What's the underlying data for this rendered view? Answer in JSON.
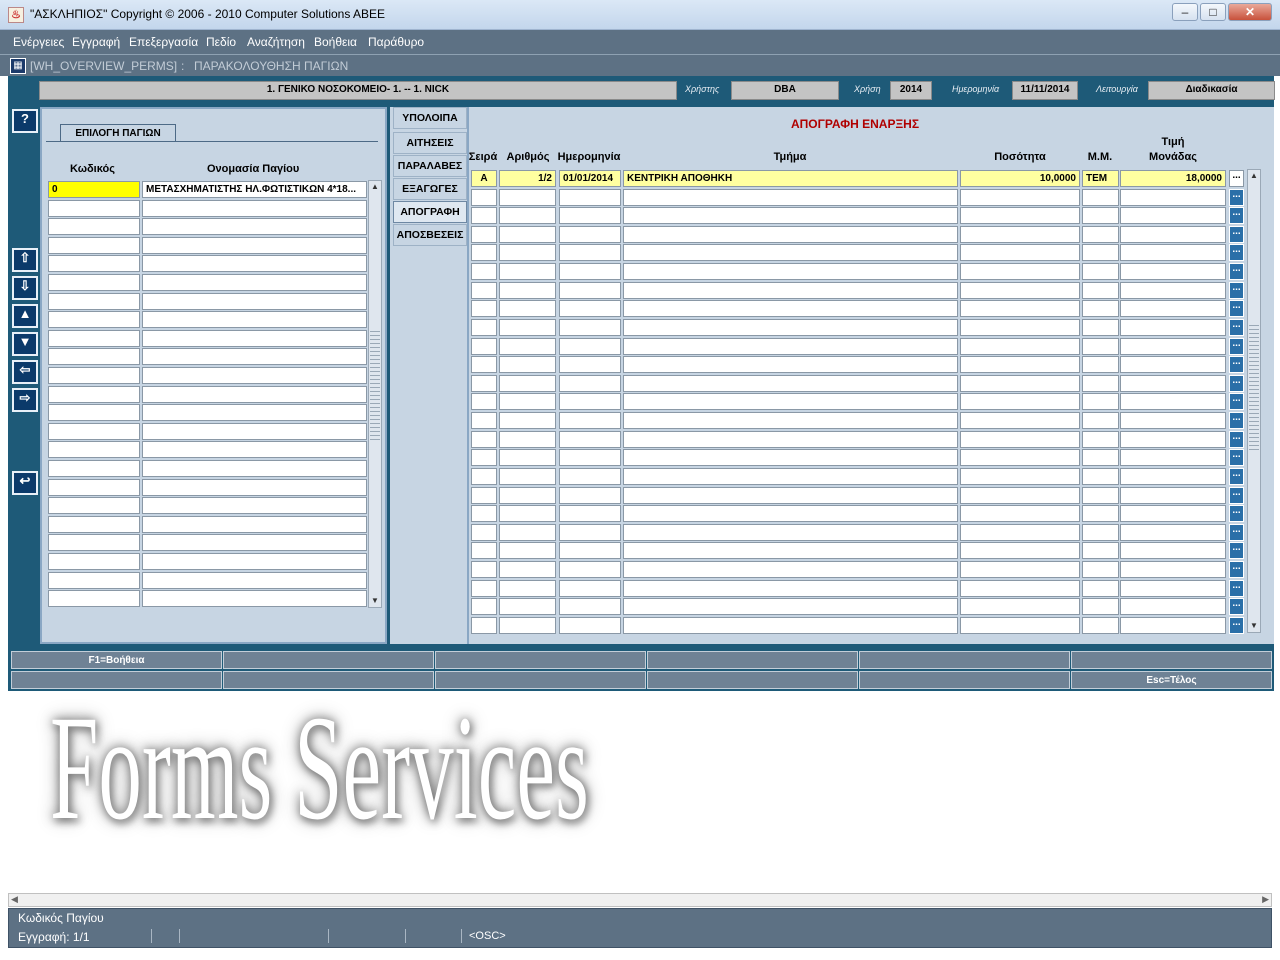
{
  "window": {
    "title": "\"ΑΣΚΛΗΠΙΟΣ\" Copyright © 2006 - 2010 Computer Solutions ABEE",
    "controls": [
      "–",
      "□",
      "✕"
    ]
  },
  "menu": [
    "Ενέργειες",
    "Εγγραφή",
    "Επεξεργασία",
    "Πεδίο",
    "Αναζήτηση",
    "Βοήθεια",
    "Παράθυρο"
  ],
  "breadcrumb": {
    "form": "[WH_OVERVIEW_PERMS]",
    "sep": ":",
    "title": "ΠΑΡΑΚΟΛΟΥΘΗΣΗ ΠΑΓΙΩΝ"
  },
  "info": {
    "org": "1. ΓΕΝΙΚΟ ΝΟΣΟΚΟΜΕΙΟ- 1. -- 1. NICK",
    "user_label": "Χρήστης",
    "user": "DBA",
    "year_label": "Χρήση",
    "year": "2014",
    "date_label": "Ημερομηνία",
    "date": "11/11/2014",
    "mode_label": "Λειτουργία",
    "mode": "Διαδικασία"
  },
  "toolbar": {
    "help": "?",
    "icons": [
      "arrow-up-icon",
      "arrow-down-icon",
      "triangle-up-icon",
      "triangle-down-icon",
      "arrow-left-icon",
      "arrow-right-icon",
      "undo-icon"
    ]
  },
  "left_panel": {
    "tab": "ΕΠΙΛΟΓΗ ΠΑΓΙΩΝ",
    "headers": {
      "code": "Κωδικός",
      "name": "Ονομασία Παγίου"
    },
    "rows": [
      {
        "code": "0",
        "name": "ΜΕΤΑΣΧΗΜΑΤΙΣΤΗΣ ΗΛ.ΦΩΤΙΣΤΙΚΩΝ 4*18..."
      }
    ]
  },
  "tabs": [
    "ΥΠΟΛΟΙΠΑ",
    "ΑΙΤΗΣΕΙΣ",
    "ΠΑΡΑΛΑΒΕΣ",
    "ΕΞΑΓΩΓΕΣ",
    "ΑΠΟΓΡΑΦΗ",
    "ΑΠΟΣΒΕΣΕΙΣ"
  ],
  "active_tab": "ΑΠΟΓΡΑΦΗ",
  "right_panel": {
    "title": "ΑΠΟΓΡΑΦΗ ΕΝΑΡΞΗΣ",
    "headers": {
      "series": "Σειρά",
      "number": "Αριθμός",
      "date": "Ημερομηνία",
      "department": "Τμήμα",
      "quantity": "Ποσότητα",
      "unit": "Μ.Μ.",
      "price_line1": "Τιμή",
      "price_line2": "Μονάδας"
    },
    "lov_button": "...",
    "rows": [
      {
        "series": "A",
        "number": "1/2",
        "date": "01/01/2014",
        "department": "ΚΕΝΤΡΙΚΗ ΑΠΟΘΗΚΗ",
        "quantity": "10,0000",
        "unit": "TEM",
        "price": "18,0000"
      }
    ]
  },
  "fkeys": {
    "row1": [
      "F1=Βοήθεια",
      "",
      "",
      "",
      "",
      ""
    ],
    "row2": [
      "",
      "",
      "",
      "",
      "",
      "Esc=Τέλος"
    ]
  },
  "watermark": "Forms Services",
  "status": {
    "hint": "Κωδικός Παγίου",
    "record": "Εγγραφή: 1/1",
    "osc": "<OSC>"
  }
}
